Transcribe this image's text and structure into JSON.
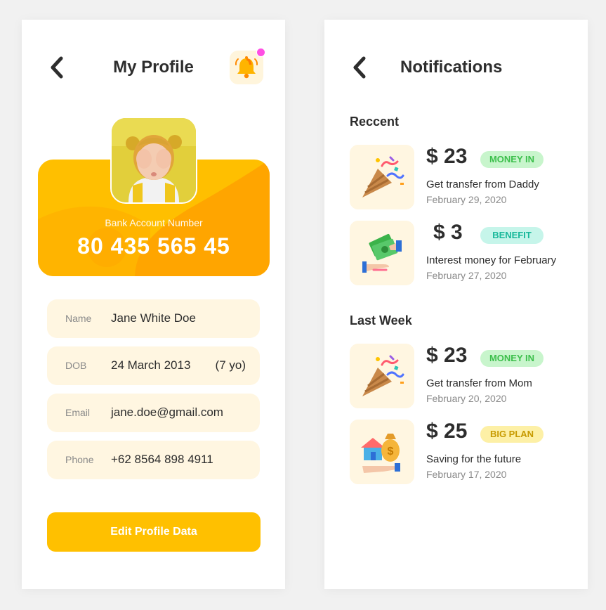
{
  "profile": {
    "title": "My Profile",
    "back_icon": "chevron-left-icon",
    "bell_icon": "bell-icon",
    "bank_label": "Bank Account Number",
    "bank_number": "80 435 565 45",
    "fields": [
      {
        "label": "Name",
        "value": "Jane White Doe"
      },
      {
        "label": "DOB",
        "value": "24 March 2013",
        "extra": "(7 yo)"
      },
      {
        "label": "Email",
        "value": "jane.doe@gmail.com"
      },
      {
        "label": "Phone",
        "value": "+62 8564 898 4911"
      }
    ],
    "edit_button": "Edit Profile Data"
  },
  "notifications": {
    "title": "Notifications",
    "back_icon": "chevron-left-icon",
    "sections": [
      {
        "title": "Reccent",
        "items": [
          {
            "icon": "party-popper-icon",
            "amount": "$ 23",
            "badge": "MONEY IN",
            "desc": "Get transfer from Daddy",
            "date": "February 29, 2020"
          },
          {
            "icon": "money-transfer-icon",
            "amount": "$ 3",
            "badge": "BENEFIT",
            "desc": "Interest money for February",
            "date": "February 27, 2020"
          }
        ]
      },
      {
        "title": "Last Week",
        "items": [
          {
            "icon": "party-popper-icon",
            "amount": "$ 23",
            "badge": "MONEY IN",
            "desc": "Get transfer from Mom",
            "date": "February 20, 2020"
          },
          {
            "icon": "house-savings-icon",
            "amount": "$ 25",
            "badge": "BIG PLAN",
            "desc": "Saving for the future",
            "date": "February 17, 2020"
          }
        ]
      }
    ]
  },
  "colors": {
    "accent": "#ffc000",
    "field_bg": "#fff6e1",
    "money_in_bg": "#c8f5cc",
    "money_in_text": "#3cbf4b",
    "benefit_bg": "#c6f5ea",
    "benefit_text": "#18b89a",
    "big_plan_bg": "#fdf0a6",
    "big_plan_text": "#c79a00",
    "notification_dot": "#ff4fe3"
  }
}
